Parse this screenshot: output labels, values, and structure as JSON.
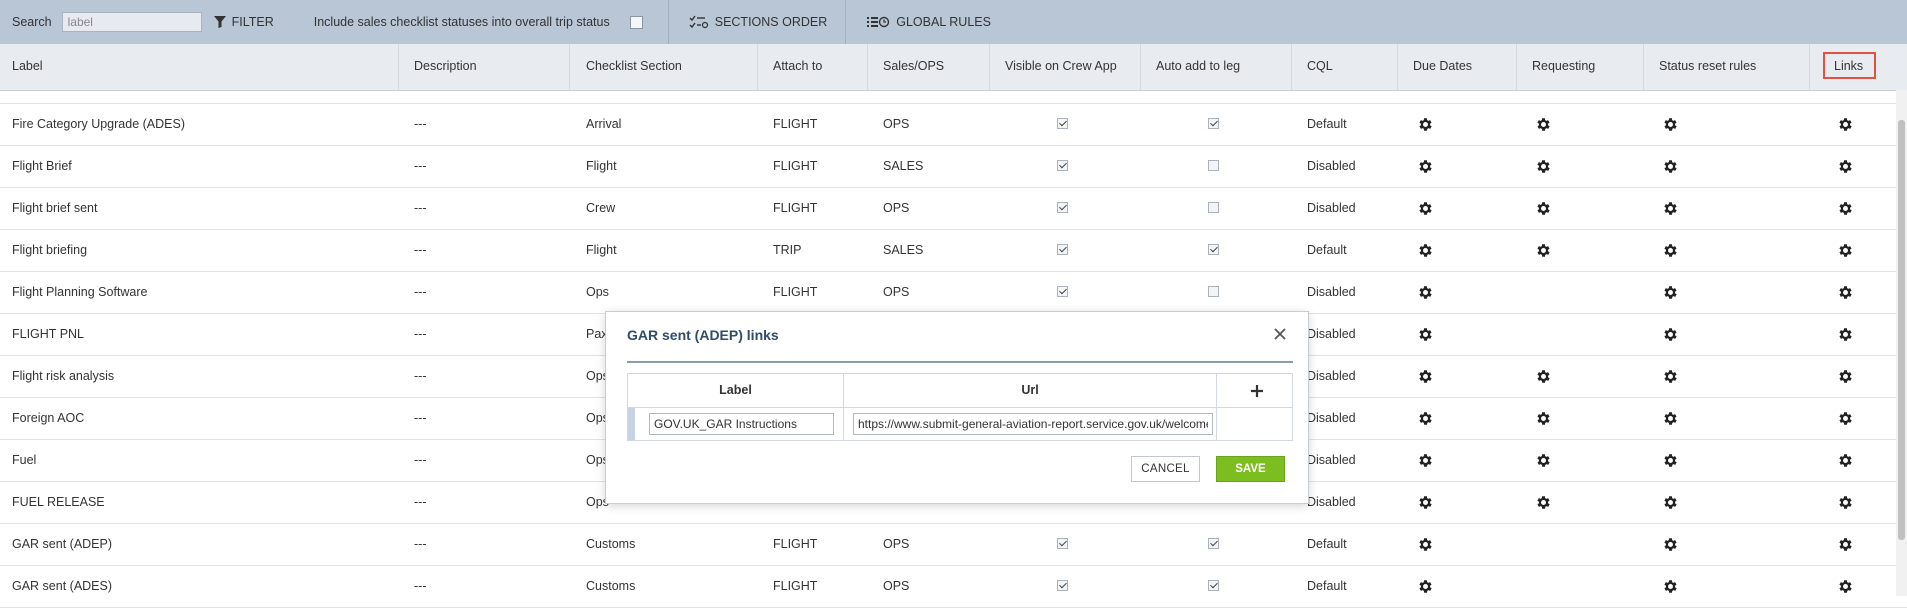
{
  "toolbar": {
    "search_label": "Search",
    "search_value": "label",
    "filter_label": "FILTER",
    "include_label": "Include sales checklist statuses into overall trip status",
    "sections_order_label": "SECTIONS ORDER",
    "global_rules_label": "GLOBAL RULES"
  },
  "columns": [
    "Label",
    "Description",
    "Checklist Section",
    "Attach to",
    "Sales/OPS",
    "Visible on Crew App",
    "Auto add to leg",
    "CQL",
    "Due Dates",
    "Requesting",
    "Status reset rules",
    "Links"
  ],
  "rows": [
    {
      "label": "Fire Category Upgrade (ADES)",
      "description": "---",
      "section": "Arrival",
      "attach": "FLIGHT",
      "sales_ops": "OPS",
      "visible": true,
      "auto_add": true,
      "cql": "Default",
      "requesting": true
    },
    {
      "label": "Flight Brief",
      "description": "---",
      "section": "Flight",
      "attach": "FLIGHT",
      "sales_ops": "SALES",
      "visible": true,
      "auto_add": false,
      "cql": "Disabled",
      "requesting": true
    },
    {
      "label": "Flight brief sent",
      "description": "---",
      "section": "Crew",
      "attach": "FLIGHT",
      "sales_ops": "OPS",
      "visible": true,
      "auto_add": false,
      "cql": "Disabled",
      "requesting": true
    },
    {
      "label": "Flight briefing",
      "description": "---",
      "section": "Flight",
      "attach": "TRIP",
      "sales_ops": "SALES",
      "visible": true,
      "auto_add": true,
      "cql": "Default",
      "requesting": true
    },
    {
      "label": "Flight Planning Software",
      "description": "---",
      "section": "Ops",
      "attach": "FLIGHT",
      "sales_ops": "OPS",
      "visible": true,
      "auto_add": false,
      "cql": "Disabled",
      "requesting": false
    },
    {
      "label": "FLIGHT PNL",
      "description": "---",
      "section": "Pax",
      "attach": "",
      "sales_ops": "",
      "visible": null,
      "auto_add": null,
      "cql": "Disabled",
      "requesting": false
    },
    {
      "label": "Flight risk analysis",
      "description": "---",
      "section": "Ops",
      "attach": "",
      "sales_ops": "",
      "visible": null,
      "auto_add": null,
      "cql": "Disabled",
      "requesting": true
    },
    {
      "label": "Foreign AOC",
      "description": "---",
      "section": "Ops",
      "attach": "",
      "sales_ops": "",
      "visible": null,
      "auto_add": null,
      "cql": "Disabled",
      "requesting": true
    },
    {
      "label": "Fuel",
      "description": "---",
      "section": "Ops",
      "attach": "",
      "sales_ops": "",
      "visible": null,
      "auto_add": null,
      "cql": "Disabled",
      "requesting": true
    },
    {
      "label": "FUEL RELEASE",
      "description": "---",
      "section": "Ops",
      "attach": "",
      "sales_ops": "",
      "visible": null,
      "auto_add": null,
      "cql": "Disabled",
      "requesting": true
    },
    {
      "label": "GAR sent (ADEP)",
      "description": "---",
      "section": "Customs",
      "attach": "FLIGHT",
      "sales_ops": "OPS",
      "visible": true,
      "auto_add": true,
      "cql": "Default",
      "requesting": false
    },
    {
      "label": "GAR sent (ADES)",
      "description": "---",
      "section": "Customs",
      "attach": "FLIGHT",
      "sales_ops": "OPS",
      "visible": true,
      "auto_add": true,
      "cql": "Default",
      "requesting": false
    }
  ],
  "modal": {
    "title": "GAR sent (ADEP) links",
    "col_label": "Label",
    "col_url": "Url",
    "link_label_value": "GOV.UK_GAR Instructions",
    "link_url_value": "https://www.submit-general-aviation-report.service.gov.uk/welcome",
    "cancel_label": "CANCEL",
    "save_label": "SAVE"
  },
  "colors": {
    "toolbar_bg": "#b9c6d6",
    "header_bg": "#e8ebef",
    "highlight": "#e15242",
    "save_green": "#7cbd1f",
    "modal_title": "#2f4b6e"
  },
  "icons": [
    "filter-icon",
    "sections-order-icon",
    "global-rules-icon",
    "gear-icon",
    "close-icon",
    "plus-icon"
  ]
}
